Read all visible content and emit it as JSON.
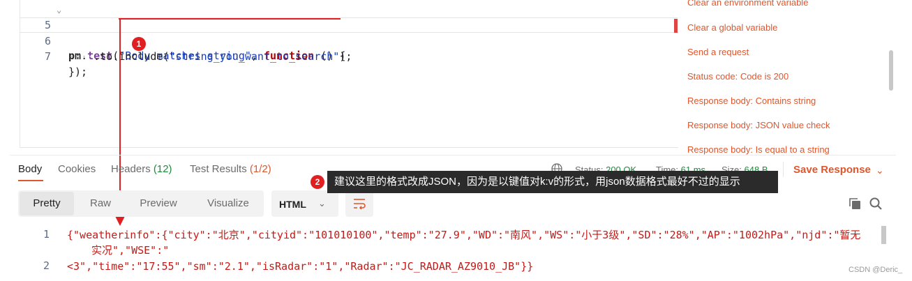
{
  "editor": {
    "lines": [
      {
        "no": "5",
        "tokens": {
          "obj": "pm",
          "dot": ".",
          "fn": "test",
          "open": "(",
          "str": "\"Body matches string\"",
          "comma": ", ",
          "kw": "function",
          "rest": " () {"
        }
      },
      {
        "no": "6",
        "tokens": {
          "dots": "····",
          "code": ".to.include(",
          "str": "\"string_you_want_to_search\"",
          "close": ");"
        }
      },
      {
        "no": "7",
        "tokens": {
          "code": "});"
        }
      }
    ]
  },
  "snippets": {
    "items": [
      "Clear an environment variable",
      "Clear a global variable",
      "Send a request",
      "Status code: Code is 200",
      "Response body: Contains string",
      "Response body: JSON value check",
      "Response body: Is equal to a string"
    ]
  },
  "response": {
    "tabs": [
      {
        "label": "Body"
      },
      {
        "label": "Cookies"
      },
      {
        "label": "Headers",
        "count": "(12)"
      },
      {
        "label": "Test Results",
        "count": "(1/2)"
      }
    ],
    "status_label": "Status:",
    "status_value": "200 OK",
    "time_label": "Time:",
    "time_value": "61 ms",
    "size_label": "Size:",
    "size_value": "648 B",
    "save_label": "Save Response",
    "views": [
      "Pretty",
      "Raw",
      "Preview",
      "Visualize"
    ],
    "format": "HTML",
    "body_lines": [
      {
        "no": "1",
        "text": "{\"weatherinfo\":{\"city\":\"北京\",\"cityid\":\"101010100\",\"temp\":\"27.9\",\"WD\":\"南风\",\"WS\":\"小于3级\",\"SD\":\"28%\",\"AP\":\"1002hPa\",\"njd\":\"暂无",
        "cont": "实况\",\"WSE\":\""
      },
      {
        "no": "2",
        "text": "<3\",\"time\":\"17:55\",\"sm\":\"2.1\",\"isRadar\":\"1\",\"Radar\":\"JC_RADAR_AZ9010_JB\"}}"
      }
    ]
  },
  "annotation": {
    "badge1": "1",
    "badge2": "2",
    "tooltip": "建议这里的格式改成JSON，因为是以键值对k:v的形式，用json数据格式最好不过的显示"
  },
  "watermark": "CSDN @Deric_",
  "colors": {
    "accent": "#e0562c",
    "success": "#1e8a3e",
    "annotation": "#e02020"
  },
  "icons": [
    "globe-icon",
    "chevron-down-icon",
    "wrap-lines-icon",
    "copy-icon",
    "search-icon"
  ]
}
